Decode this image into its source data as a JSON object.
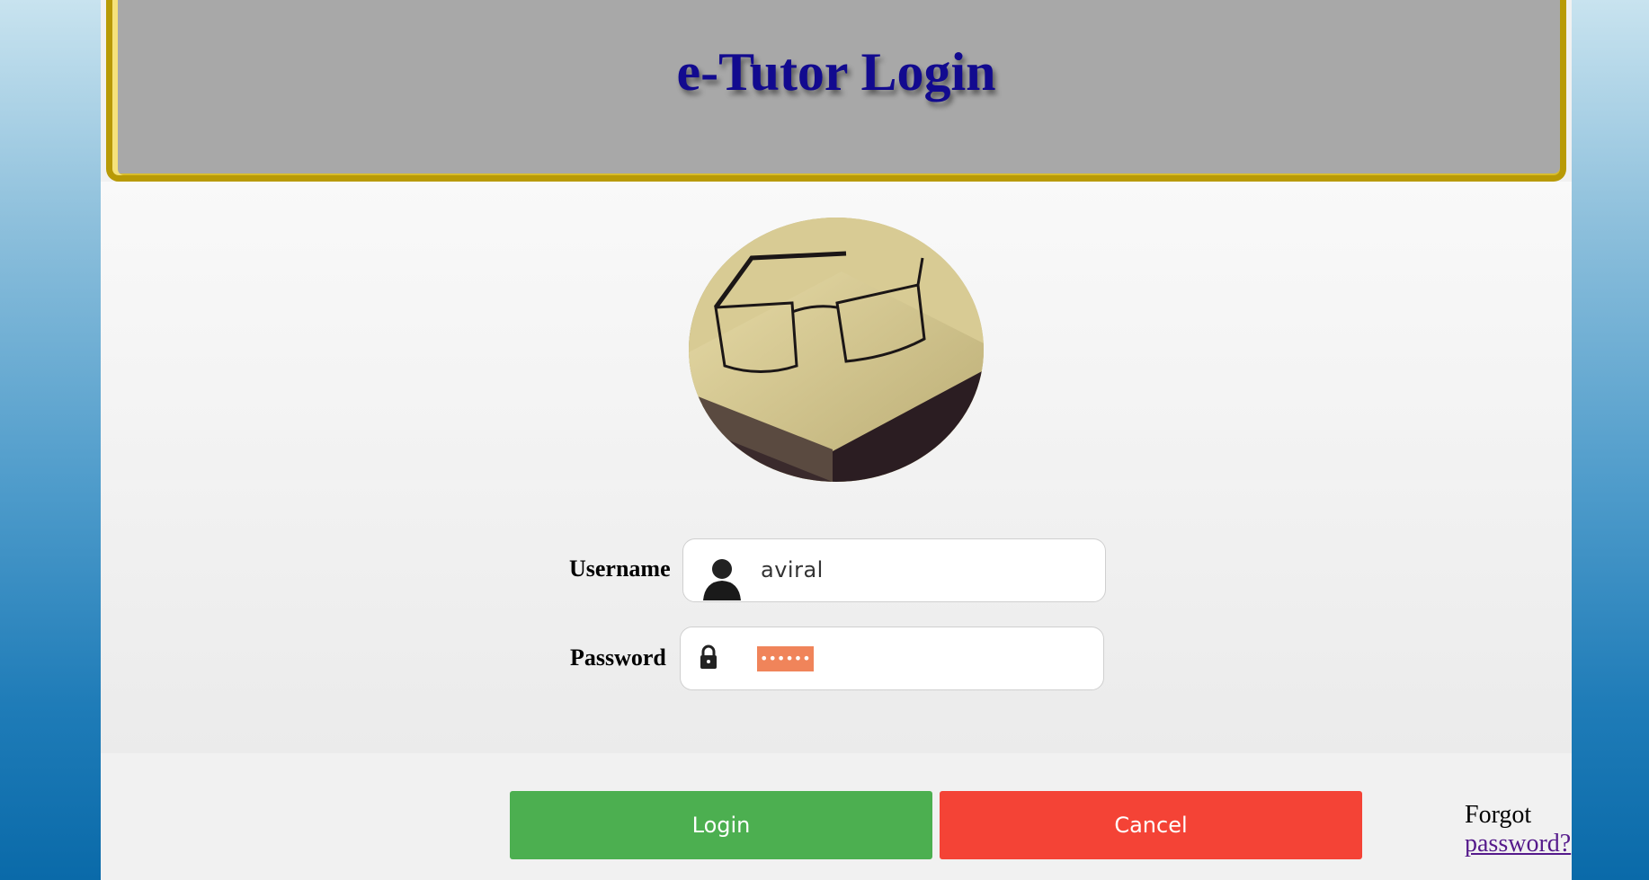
{
  "header": {
    "title": "e-Tutor Login"
  },
  "form": {
    "username_label": "Username",
    "username_value": "aviral",
    "password_label": "Password",
    "password_value": "••••••"
  },
  "buttons": {
    "login": "Login",
    "cancel": "Cancel"
  },
  "forgot": {
    "prefix": "Forgot",
    "link": "password?"
  },
  "icons": {
    "user": "user-silhouette-icon",
    "lock": "lock-icon",
    "avatar": "glasses-on-book-image"
  },
  "colors": {
    "title": "#120a8f",
    "header_bg": "#a8a8a8",
    "header_border": "#b89a06",
    "login_button": "#4caf50",
    "cancel_button": "#f44336",
    "link": "#551a8b"
  }
}
